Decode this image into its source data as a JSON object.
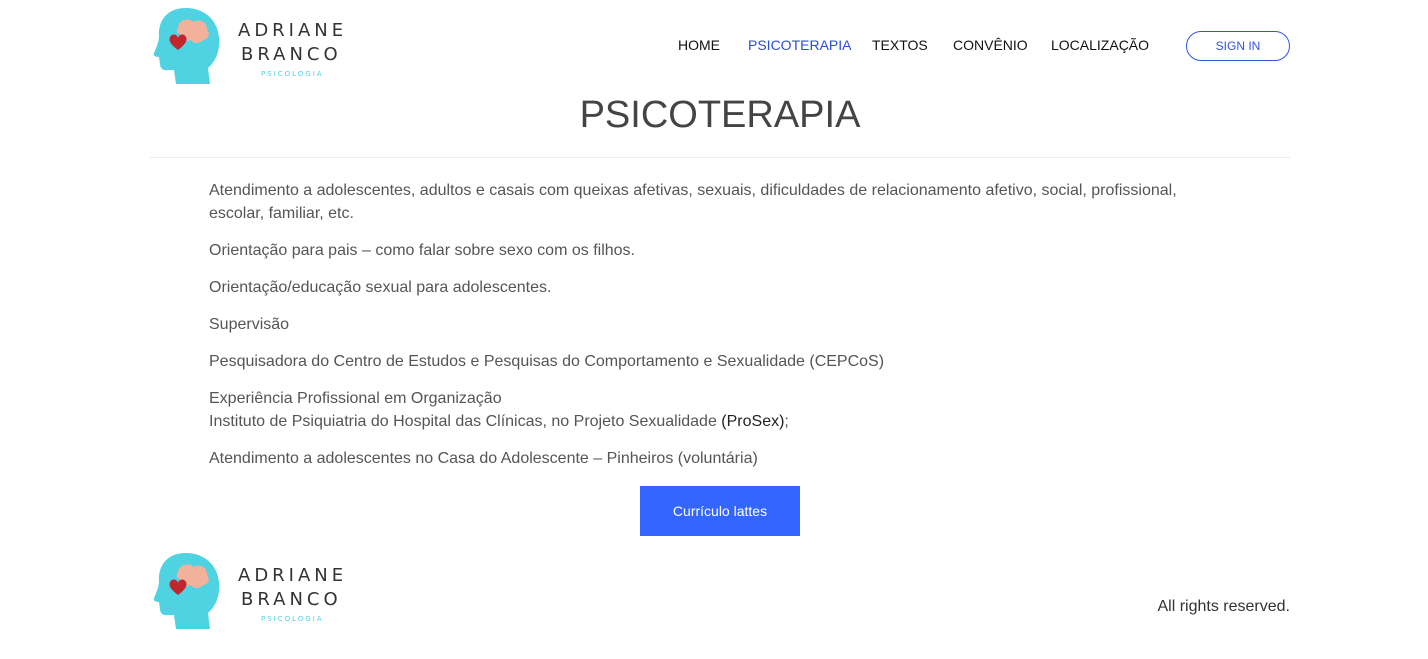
{
  "brand": {
    "name_line1": "ADRIANE",
    "name_line2": "BRANCO",
    "tagline": "PSICOLOGIA",
    "colors": {
      "head": "#4fd2e2",
      "heart": "#c0262c",
      "brain": "#f2b19b"
    }
  },
  "nav": {
    "items": [
      "HOME",
      "PSICOTERAPIA",
      "TEXTOS",
      "CONVÊNIO",
      "LOCALIZAÇÃO"
    ],
    "active": "PSICOTERAPIA",
    "signin_label": "SIGN IN",
    "accent": "#3056e0"
  },
  "page": {
    "title": "PSICOTERAPIA",
    "paragraphs": [
      "Atendimento a adolescentes, adultos e casais com queixas afetivas, sexuais, dificuldades de relacionamento afetivo, social, profissional, escolar, familiar, etc.",
      "Orientação para pais – como falar sobre sexo com os filhos.",
      "Orientação/educação sexual para adolescentes.",
      "Supervisão",
      "Pesquisadora do Centro de Estudos e Pesquisas do Comportamento e Sexualidade (CEPCoS)",
      "Experiência Profissional em Organização",
      "Instituto de Psiquiatria do Hospital das Clínicas, no Projeto Sexualidade ",
      "(ProSex)",
      ";",
      "Atendimento a adolescentes no Casa do Adolescente – Pinheiros (voluntária)"
    ],
    "cta_label": "Currículo lattes",
    "cta_color": "#3366ff"
  },
  "footer": {
    "rights": "All rights reserved."
  }
}
